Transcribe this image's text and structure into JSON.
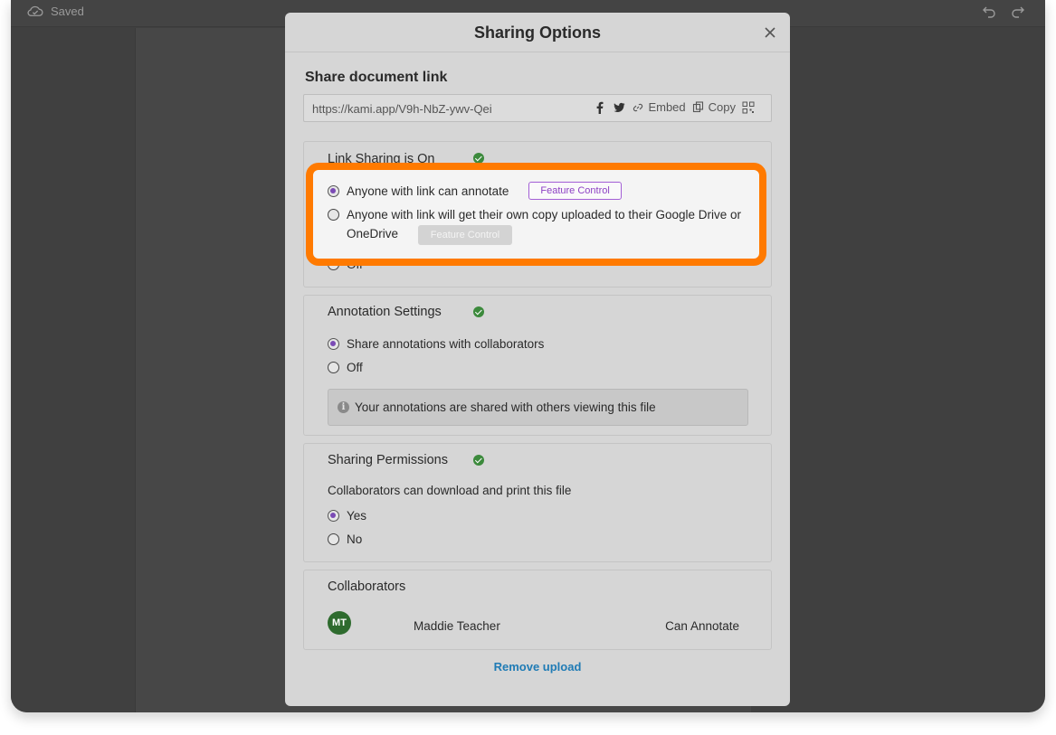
{
  "topbar": {
    "saved_label": "Saved",
    "icons": [
      "cloud-check-icon",
      "undo-icon",
      "redo-icon"
    ]
  },
  "modal": {
    "title": "Sharing Options",
    "share_heading": "Share document link",
    "link_url": "https://kami.app/V9h-NbZ-ywv-Qei",
    "link_actions": {
      "embed_label": "Embed",
      "copy_label": "Copy"
    },
    "link_sharing": {
      "title": "Link Sharing is On",
      "option_annotate": "Anyone with link can annotate",
      "option_copy": "Anyone with link will get their own copy uploaded to their Google Drive or OneDrive",
      "feature_control_label": "Feature Control",
      "feature_control_disabled_label": "Feature Control",
      "option_off": "Off",
      "selected": "annotate"
    },
    "annotation_settings": {
      "title": "Annotation Settings",
      "option_share": "Share annotations with collaborators",
      "option_off": "Off",
      "selected": "share",
      "info_text": "Your annotations are shared with others viewing this file"
    },
    "sharing_permissions": {
      "title": "Sharing Permissions",
      "question": "Collaborators can download and print this file",
      "option_yes": "Yes",
      "option_no": "No",
      "selected": "yes"
    },
    "collaborators": {
      "title": "Collaborators",
      "items": [
        {
          "initials": "MT",
          "name": "Maddie Teacher",
          "permission": "Can Annotate"
        }
      ]
    },
    "remove_label": "Remove upload"
  },
  "colors": {
    "highlight": "#ff7a00",
    "accent_purple": "#7b4bb5",
    "link_blue": "#1f7bb5",
    "check_green": "#3c8a3c",
    "avatar_green": "#2e6b2e"
  }
}
